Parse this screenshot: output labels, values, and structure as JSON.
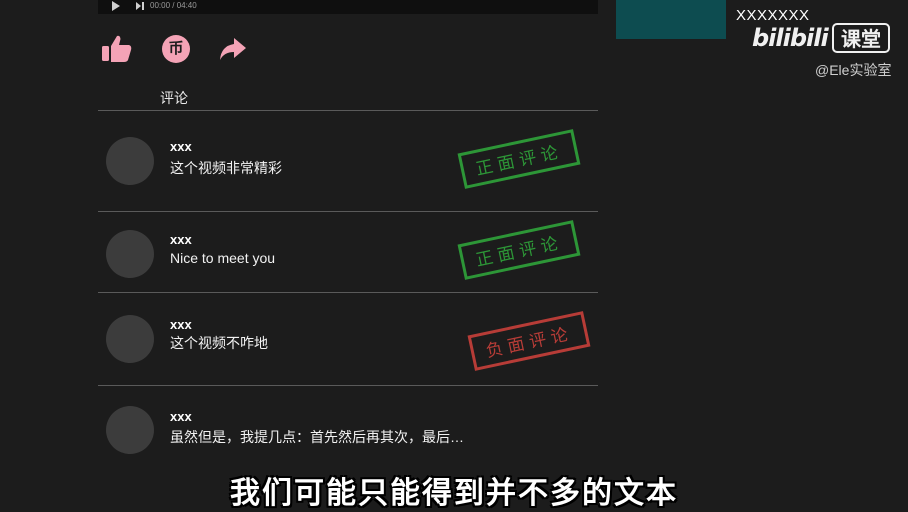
{
  "player": {
    "time": "00:00 / 04:40"
  },
  "branding": {
    "corner_name": "XXXXXXX",
    "logo": "bilibili",
    "course": "课堂",
    "handle": "@Ele实验室"
  },
  "actions": {
    "like_icon": "thumbs-up-icon",
    "coin_glyph": "币",
    "share_icon": "share-arrow-icon",
    "accent": "#f4a3b6"
  },
  "comments_title": "评论",
  "comments": [
    {
      "user": "xxx",
      "text": "这个视频非常精彩",
      "stamp": "正面评论",
      "sentiment": "positive"
    },
    {
      "user": "xxx",
      "text": "Nice to meet you",
      "stamp": "正面评论",
      "sentiment": "positive"
    },
    {
      "user": "xxx",
      "text": "这个视频不咋地",
      "stamp": "负面评论",
      "sentiment": "negative"
    },
    {
      "user": "xxx",
      "text": "虽然但是，我提几点：首先然后再其次，最后…",
      "stamp": "",
      "sentiment": ""
    }
  ],
  "subtitle": "我们可能只能得到并不多的文本",
  "colors": {
    "background": "#1c1c1c",
    "positive": "#2fa43a",
    "negative": "#c8403a",
    "teal": "#0d4c50"
  }
}
